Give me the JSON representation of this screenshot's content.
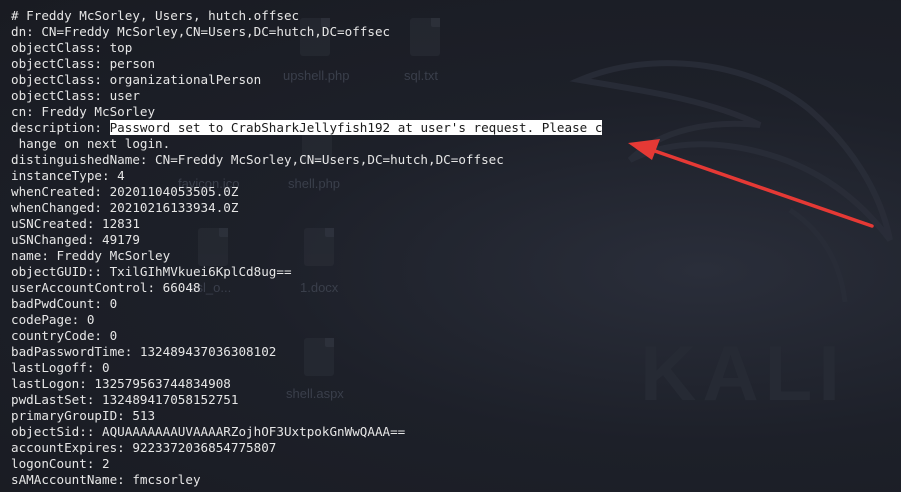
{
  "desktop": {
    "icons": [
      {
        "label": "upshell.php"
      },
      {
        "label": "sql.txt"
      },
      {
        "label": "shell.php"
      },
      {
        "label": "favicon.ico"
      },
      {
        "label": "1.docx"
      },
      {
        "label": "shell.aspx"
      },
      {
        "label": "ssl_o..."
      }
    ],
    "brand": "KALI"
  },
  "terminal": {
    "header": "# Freddy McSorley, Users, hutch.offsec",
    "lines_before": [
      "dn: CN=Freddy McSorley,CN=Users,DC=hutch,DC=offsec",
      "objectClass: top",
      "objectClass: person",
      "objectClass: organizationalPerson",
      "objectClass: user",
      "cn: Freddy McSorley"
    ],
    "description_key": "description: ",
    "description_value": "Password set to CrabSharkJellyfish192 at user's request. Please c",
    "description_wrap": " hange on next login.",
    "lines_after": [
      "distinguishedName: CN=Freddy McSorley,CN=Users,DC=hutch,DC=offsec",
      "instanceType: 4",
      "whenCreated: 20201104053505.0Z",
      "whenChanged: 20210216133934.0Z",
      "uSNCreated: 12831",
      "uSNChanged: 49179",
      "name: Freddy McSorley",
      "objectGUID:: TxilGIhMVkuei6KplCd8ug==",
      "userAccountControl: 66048",
      "badPwdCount: 0",
      "codePage: 0",
      "countryCode: 0",
      "badPasswordTime: 132489437036308102",
      "lastLogoff: 0",
      "lastLogon: 132579563744834908",
      "pwdLastSet: 132489417058152751",
      "primaryGroupID: 513",
      "objectSid:: AQUAAAAAAAUVAAAARZojhOF3UxtpokGnWwQAAA==",
      "accountExpires: 9223372036854775807",
      "logonCount: 2",
      "sAMAccountName: fmcsorley"
    ]
  },
  "annotation": {
    "arrow_color": "#e53935"
  }
}
